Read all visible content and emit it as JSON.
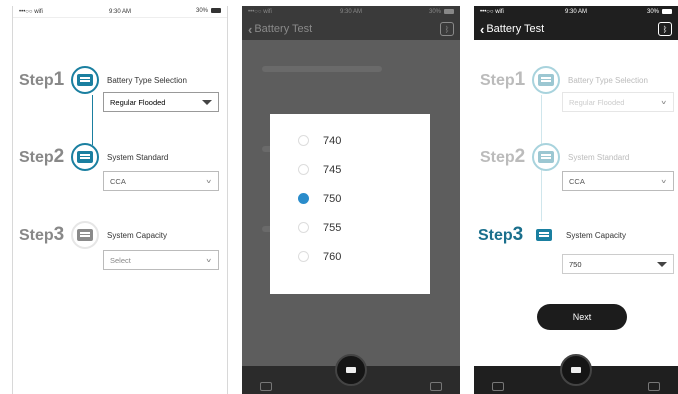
{
  "screen1": {
    "status": {
      "carrier": "•••○○ wifi",
      "time": "9:30 AM",
      "battery": "30%"
    },
    "steps": [
      {
        "step": "Step",
        "num": "1",
        "title": "Battery Type Selection",
        "value": "Regular Flooded"
      },
      {
        "step": "Step",
        "num": "2",
        "title": "System Standard",
        "value": "CCA"
      },
      {
        "step": "Step",
        "num": "3",
        "title": "System Capacity",
        "value": "Select"
      }
    ]
  },
  "screen2": {
    "status": {
      "carrier": "•••○○ wifi",
      "time": "9:30 AM",
      "battery": "30%"
    },
    "nav": {
      "back": "Battery Test"
    },
    "options": [
      "740",
      "745",
      "750",
      "755",
      "760"
    ],
    "selected": "750"
  },
  "screen3": {
    "status": {
      "carrier": "•••○○ wifi",
      "time": "9:30 AM",
      "battery": "30%"
    },
    "nav": {
      "back": "Battery Test"
    },
    "steps": [
      {
        "step": "Step",
        "num": "1",
        "title": "Battery Type Selection",
        "value": "Regular Flooded"
      },
      {
        "step": "Step",
        "num": "2",
        "title": "System Standard",
        "value": "CCA"
      },
      {
        "step": "Step",
        "num": "3",
        "title": "System Capacity",
        "value": "750"
      }
    ],
    "next_label": "Next"
  },
  "colors": {
    "accent": "#1a7fa0",
    "step_gray": "#888888",
    "radio_selected": "#2a8ccb"
  },
  "icons": {
    "back": "chevron-left-icon",
    "bluetooth": "bluetooth-icon",
    "step": "battery-icon",
    "radio": "radio-icon",
    "camera": "camera-icon"
  }
}
